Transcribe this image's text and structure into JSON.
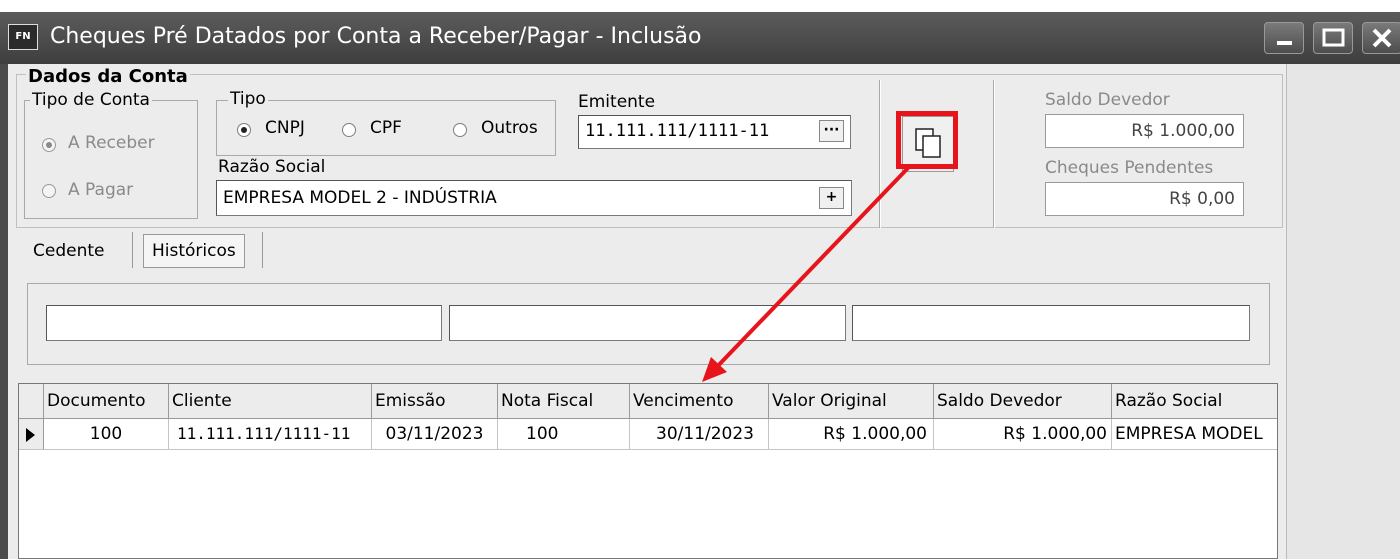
{
  "window": {
    "app_icon": "FN",
    "title": "Cheques Pré Datados por Conta a Receber/Pagar - Inclusão"
  },
  "form": {
    "group_title": "Dados da Conta",
    "tipo_conta": {
      "legend": "Tipo de Conta",
      "option_receber": "A Receber",
      "option_pagar": "A Pagar"
    },
    "tipo": {
      "legend": "Tipo",
      "option_cnpj": "CNPJ",
      "option_cpf": "CPF",
      "option_outros": "Outros"
    },
    "emitente_label": "Emitente",
    "emitente_value": "11.111.111/1111-11",
    "emitente_button": "···",
    "razao_label": "Razão Social",
    "razao_value": "EMPRESA MODEL 2 - INDÚSTRIA",
    "razao_button": "+",
    "copy_icon": "copy-icon",
    "saldo_devedor_label": "Saldo Devedor",
    "saldo_devedor_value": "R$ 1.000,00",
    "cheques_pendentes_label": "Cheques Pendentes",
    "cheques_pendentes_value": "R$ 0,00"
  },
  "tabs": {
    "cedente": "Cedente",
    "historicos": "Históricos"
  },
  "grid": {
    "headers": [
      "Documento",
      "Cliente",
      "Emissão",
      "Nota Fiscal",
      "Vencimento",
      "Valor Original",
      "Saldo Devedor",
      "Razão Social"
    ],
    "row": {
      "documento": "100",
      "cliente": "11.111.111/1111-11",
      "emissao": "03/11/2023",
      "nota_fiscal": "100",
      "vencimento": "30/11/2023",
      "valor_original": "R$ 1.000,00",
      "saldo_devedor": "R$ 1.000,00",
      "razao_social": "EMPRESA MODEL"
    }
  },
  "annotation": {
    "highlight_color": "#e8141b"
  }
}
